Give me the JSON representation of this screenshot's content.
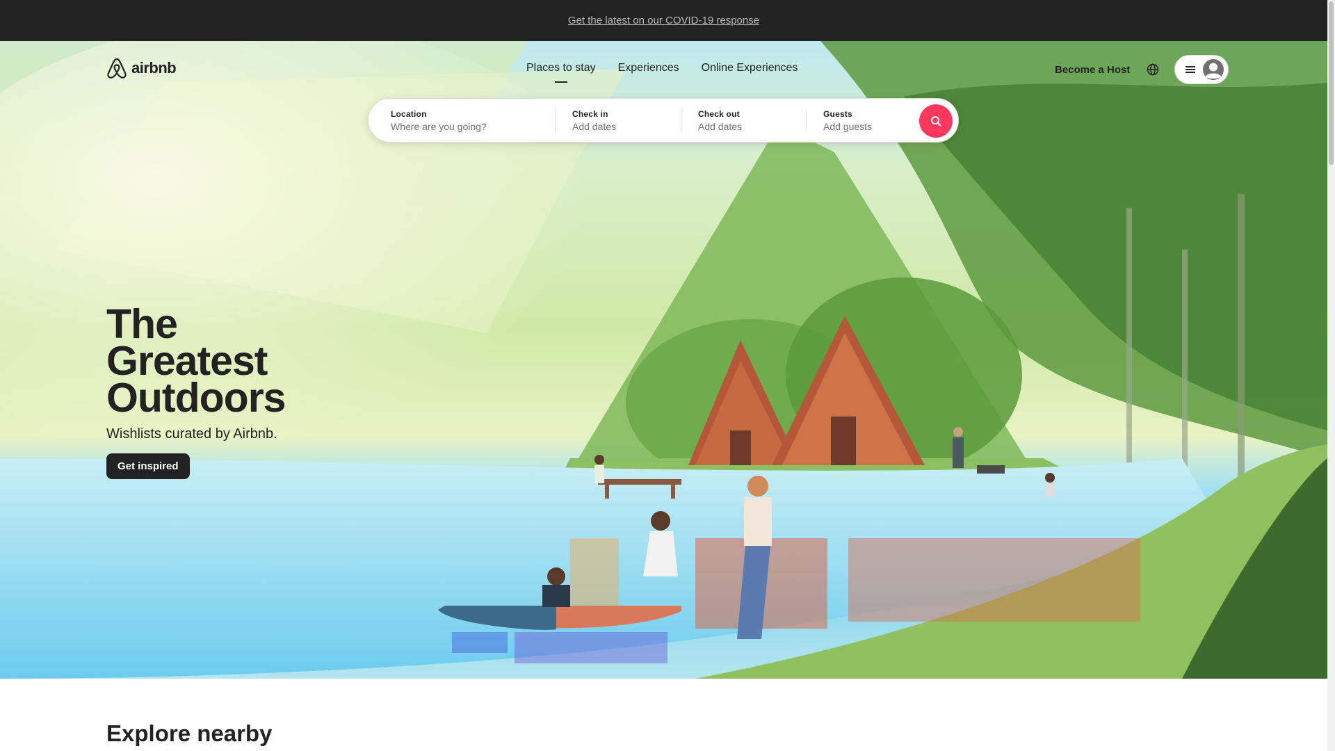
{
  "banner": {
    "text": "Get the latest on our COVID-19 response"
  },
  "header": {
    "logo_text": "airbnb",
    "nav": [
      "Places to stay",
      "Experiences",
      "Online Experiences"
    ],
    "become_host": "Become a Host",
    "icons": {
      "globe": "globe-icon",
      "menu": "menu-icon",
      "avatar": "user-avatar-icon"
    }
  },
  "search": {
    "location": {
      "label": "Location",
      "placeholder": "Where are you going?"
    },
    "check_in": {
      "label": "Check in",
      "value": "Add dates"
    },
    "check_out": {
      "label": "Check out",
      "value": "Add dates"
    },
    "guests": {
      "label": "Guests",
      "value": "Add guests"
    },
    "button_icon": "search-icon"
  },
  "hero": {
    "title_lines": [
      "The",
      "Greatest",
      "Outdoors"
    ],
    "subtitle": "Wishlists curated by Airbnb.",
    "cta": "Get inspired"
  },
  "explore": {
    "heading": "Explore nearby"
  },
  "colors": {
    "brand": "#ff385c",
    "dark": "#222222",
    "banner_bg": "#222222"
  }
}
